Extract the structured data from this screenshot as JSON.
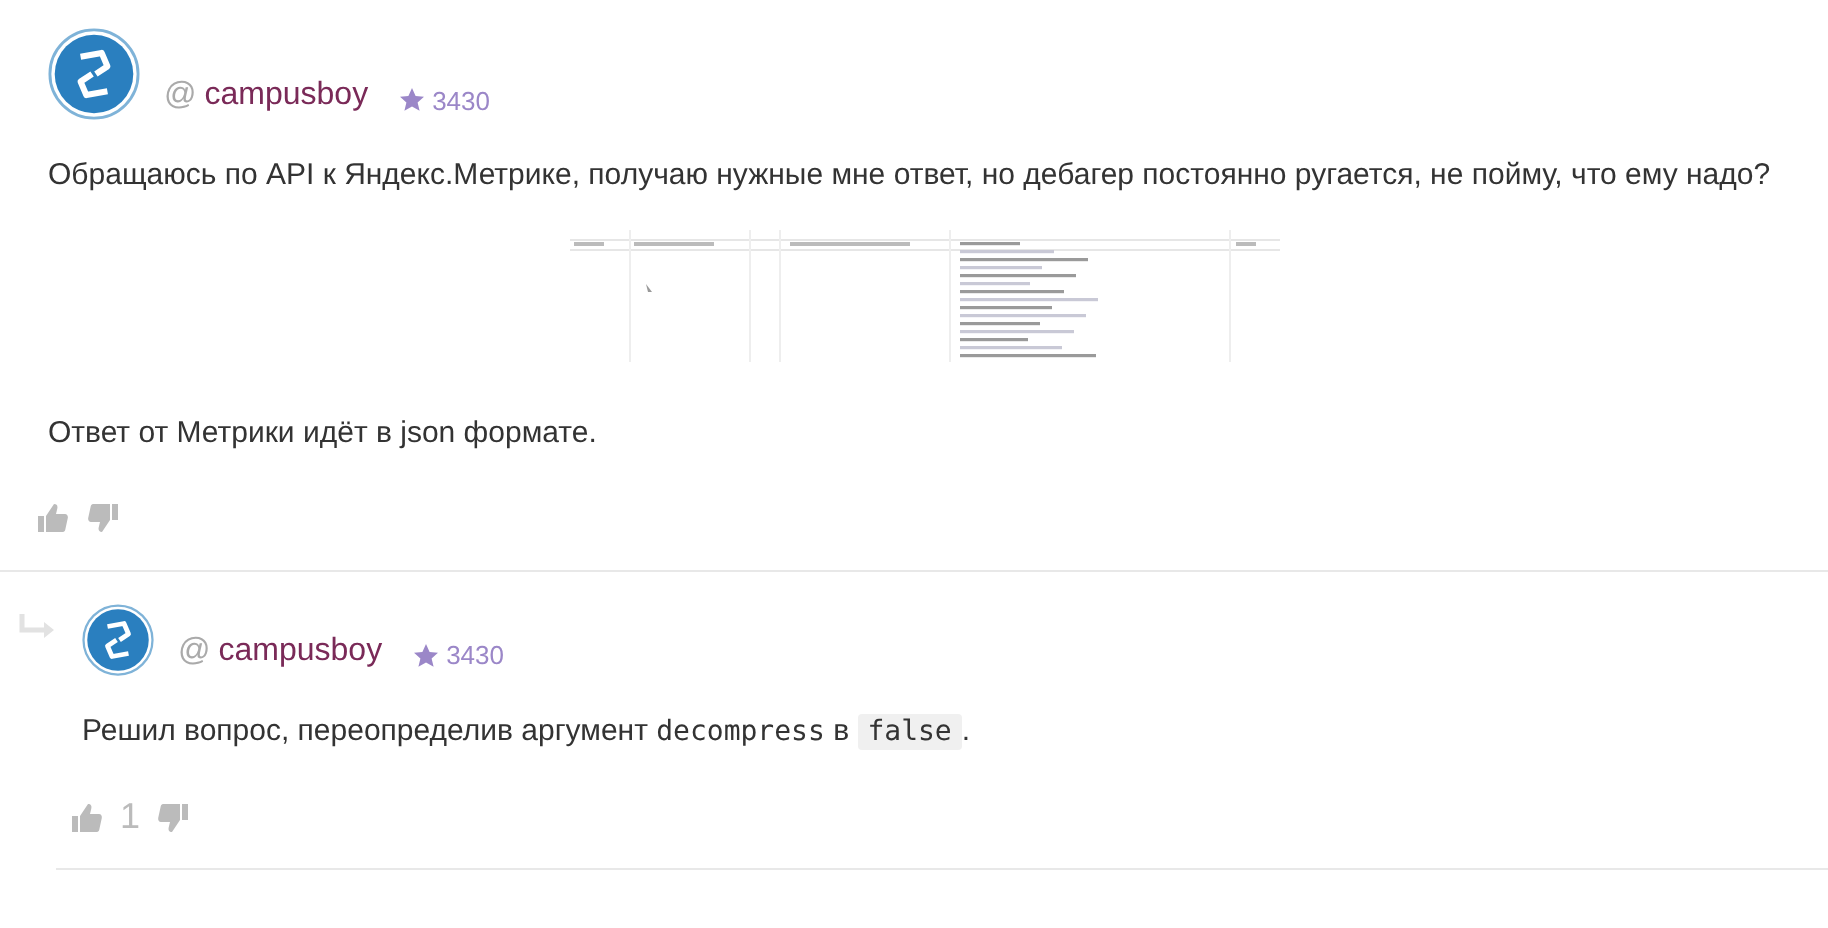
{
  "comments": [
    {
      "user": {
        "at": "@",
        "name": "campusboy",
        "rating": "3430"
      },
      "is_reply": false,
      "body": [
        {
          "kind": "paragraph",
          "segments": [
            {
              "kind": "text",
              "text": "Обращаюсь по API к Яндекс.Метрике, получаю нужные мне ответ, но дебагер постоянно ругается, не пойму, что ему надо?"
            }
          ]
        },
        {
          "kind": "picture"
        },
        {
          "kind": "paragraph",
          "segments": [
            {
              "kind": "text",
              "text": "Ответ от Метрики идёт в json формате."
            }
          ]
        }
      ]
    },
    {
      "user": {
        "at": "@",
        "name": "campusboy",
        "rating": "3430"
      },
      "is_reply": true,
      "votes": "1",
      "body": [
        {
          "kind": "paragraph",
          "segments": [
            {
              "kind": "text",
              "text": "Решил вопрос, переопределив аргумент "
            },
            {
              "kind": "code",
              "text": "decompress"
            },
            {
              "kind": "text",
              "text": " в "
            },
            {
              "kind": "codebox",
              "text": "false"
            },
            {
              "kind": "text",
              "text": "."
            }
          ]
        }
      ]
    }
  ]
}
